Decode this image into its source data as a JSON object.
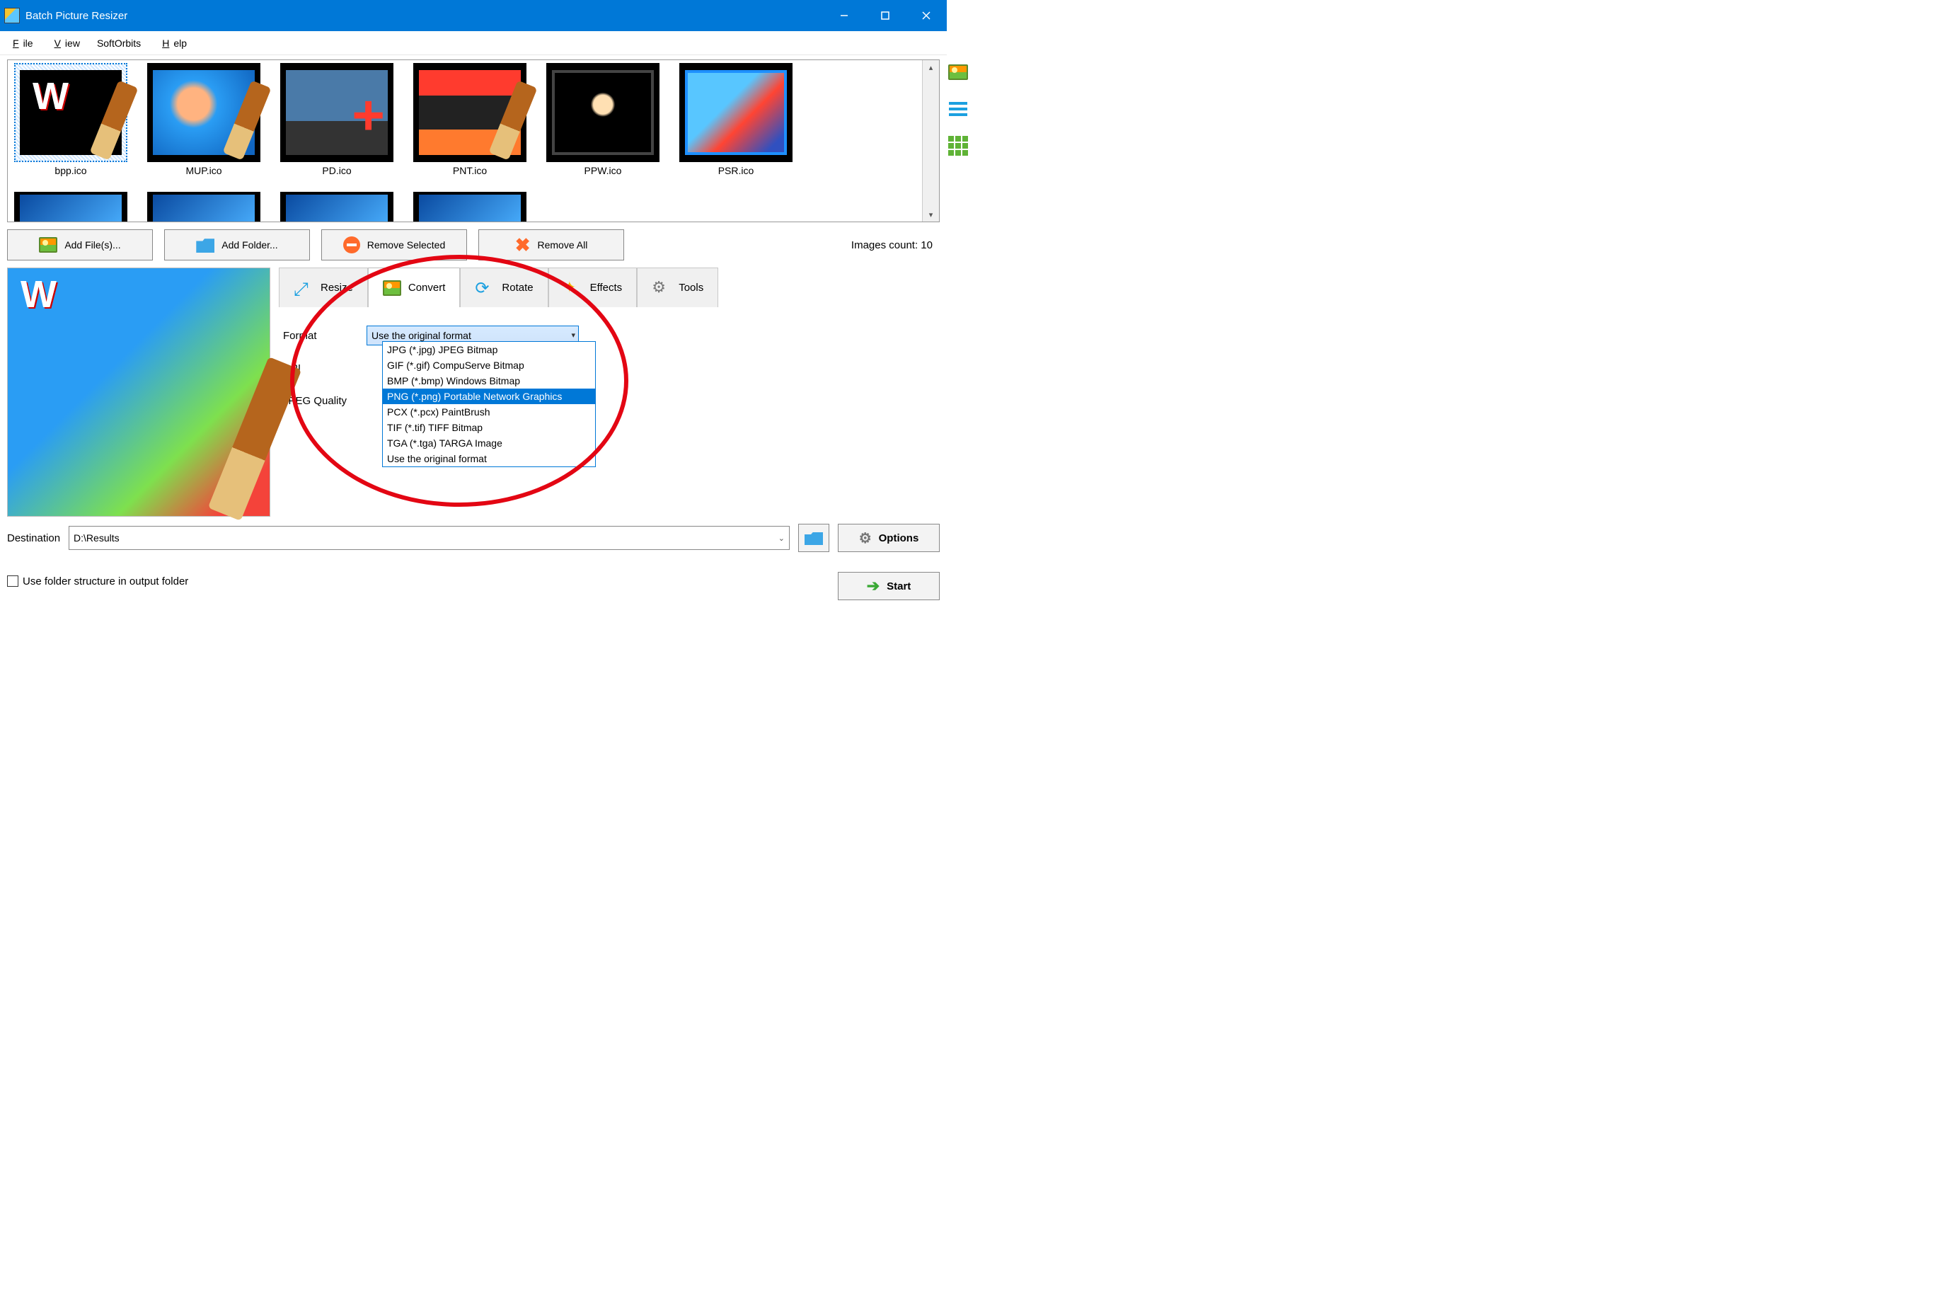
{
  "titlebar": {
    "title": "Batch Picture Resizer"
  },
  "menu": {
    "file": "File",
    "view": "View",
    "softorbits": "SoftOrbits",
    "help": "Help"
  },
  "thumbnails": [
    {
      "label": "bpp.ico"
    },
    {
      "label": "MUP.ico"
    },
    {
      "label": "PD.ico"
    },
    {
      "label": "PNT.ico"
    },
    {
      "label": "PPW.ico"
    },
    {
      "label": "PSR.ico"
    }
  ],
  "toolbar": {
    "add_files": "Add File(s)...",
    "add_folder": "Add Folder...",
    "remove_selected": "Remove Selected",
    "remove_all": "Remove All",
    "images_count_label": "Images count: 10"
  },
  "tabs": {
    "resize": "Resize",
    "convert": "Convert",
    "rotate": "Rotate",
    "effects": "Effects",
    "tools": "Tools"
  },
  "convert_panel": {
    "format_label": "Format",
    "format_value": "Use the original format",
    "dpi_label": "DPI",
    "jpeg_label": "JPEG Quality"
  },
  "format_options": [
    "JPG (*.jpg) JPEG Bitmap",
    "GIF (*.gif) CompuServe Bitmap",
    "BMP (*.bmp) Windows Bitmap",
    "PNG (*.png) Portable Network Graphics",
    "PCX (*.pcx) PaintBrush",
    "TIF (*.tif) TIFF Bitmap",
    "TGA (*.tga) TARGA Image",
    "Use the original format"
  ],
  "destination": {
    "label": "Destination",
    "value": "D:\\Results",
    "use_folder_structure": "Use folder structure in output folder",
    "options": "Options",
    "start": "Start"
  }
}
